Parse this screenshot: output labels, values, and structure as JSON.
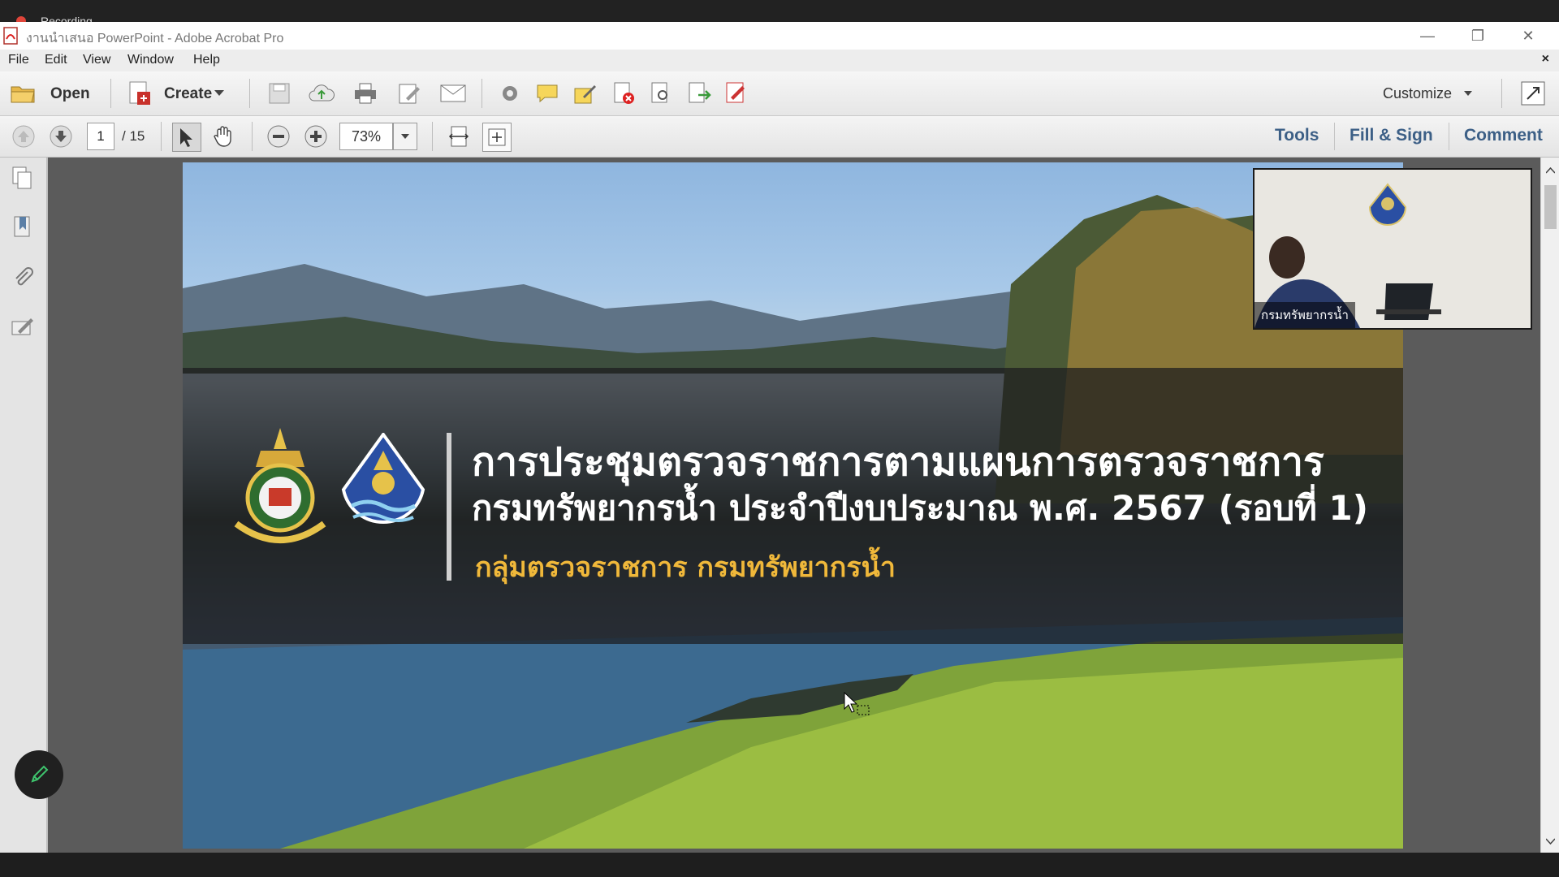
{
  "recording": {
    "label": "Recording"
  },
  "window": {
    "title": "งานนำเสนอ PowerPoint - Adobe Acrobat Pro"
  },
  "menu": {
    "items": [
      "File",
      "Edit",
      "View",
      "Window",
      "Help"
    ],
    "close": "×"
  },
  "toolbar": {
    "open_label": "Open",
    "create_label": "Create",
    "customize_label": "Customize"
  },
  "nav": {
    "page_current": "1",
    "page_total": "/ 15",
    "zoom": "73%"
  },
  "panels": {
    "tools": "Tools",
    "fill_sign": "Fill & Sign",
    "comment": "Comment"
  },
  "slide": {
    "title_line1": "การประชุมตรวจราชการตามแผนการตรวจราชการ",
    "title_line2": "กรมทรัพยากรน้ำ ประจำปีงบประมาณ พ.ศ. 2567 (รอบที่ 1)",
    "subtitle": "กลุ่มตรวจราชการ กรมทรัพยากรน้ำ"
  },
  "video": {
    "participant_name": "กรมทรัพยากรน้ำ"
  },
  "colors": {
    "accent_blue": "#3c5f86",
    "subtitle_gold": "#f0b83a",
    "recording_red": "#e0453a",
    "pen_green": "#3ec46d"
  }
}
